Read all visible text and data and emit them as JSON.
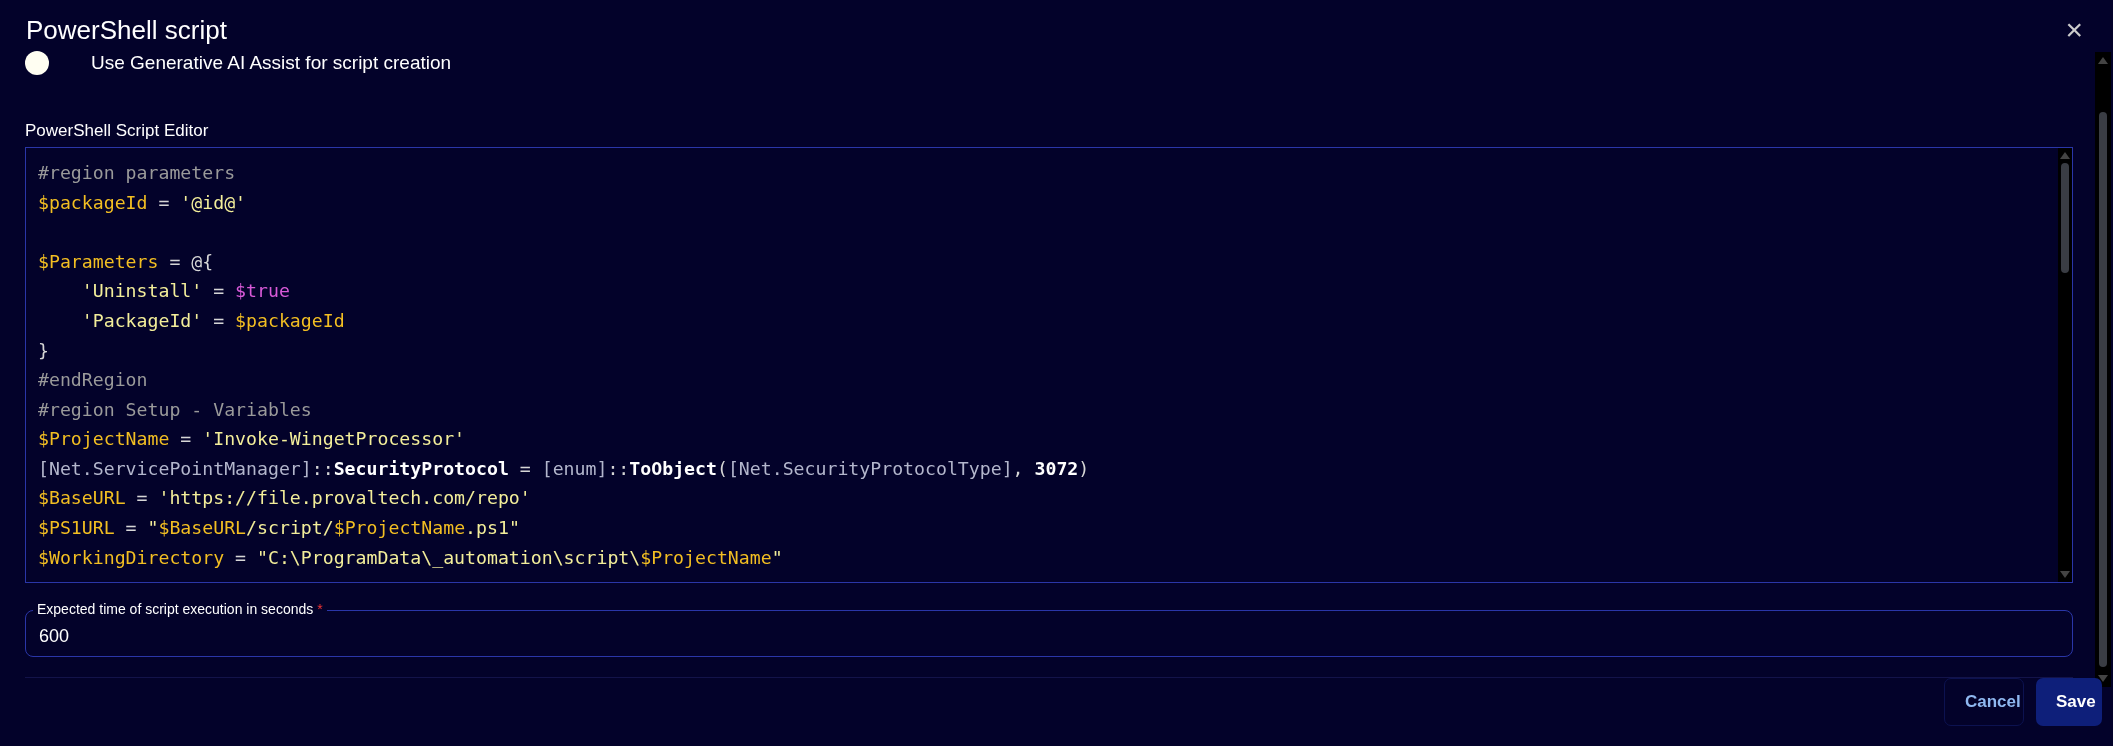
{
  "dialog": {
    "title": "PowerShell script",
    "close": "×"
  },
  "ai_toggle": {
    "label": "Use Generative AI Assist for script creation",
    "on": false
  },
  "editor": {
    "label": "PowerShell Script Editor",
    "lines": [
      {
        "kind": "code",
        "tokens": [
          {
            "t": "#region parameters",
            "kind": "comment"
          }
        ]
      },
      {
        "kind": "code",
        "tokens": [
          {
            "t": "$packageId",
            "kind": "var"
          },
          {
            "t": " = ",
            "kind": "op"
          },
          {
            "t": "'@id@'",
            "kind": "str"
          }
        ]
      },
      {
        "kind": "blank"
      },
      {
        "kind": "code",
        "tokens": [
          {
            "t": "$Parameters",
            "kind": "var"
          },
          {
            "t": " = @{",
            "kind": "op"
          }
        ]
      },
      {
        "kind": "code",
        "indent": true,
        "tokens": [
          {
            "t": "'Uninstall'",
            "kind": "str"
          },
          {
            "t": " = ",
            "kind": "op"
          },
          {
            "t": "$true",
            "kind": "bool"
          }
        ]
      },
      {
        "kind": "code",
        "indent": true,
        "tokens": [
          {
            "t": "'PackageId'",
            "kind": "str"
          },
          {
            "t": " = ",
            "kind": "op"
          },
          {
            "t": "$packageId",
            "kind": "var"
          }
        ]
      },
      {
        "kind": "code",
        "tokens": [
          {
            "t": "}",
            "kind": "op"
          }
        ]
      },
      {
        "kind": "code",
        "tokens": [
          {
            "t": "#endRegion",
            "kind": "comment"
          }
        ]
      },
      {
        "kind": "code",
        "tokens": [
          {
            "t": "#region Setup - Variables",
            "kind": "comment"
          }
        ]
      },
      {
        "kind": "code",
        "tokens": [
          {
            "t": "$ProjectName",
            "kind": "var"
          },
          {
            "t": " = ",
            "kind": "op"
          },
          {
            "t": "'Invoke-WingetProcessor'",
            "kind": "str"
          }
        ]
      },
      {
        "kind": "code",
        "tokens": [
          {
            "t": "[Net.ServicePointManager]",
            "kind": "type"
          },
          {
            "t": "::",
            "kind": "op"
          },
          {
            "t": "SecurityProtocol",
            "kind": "member"
          },
          {
            "t": " = ",
            "kind": "op"
          },
          {
            "t": "[enum]",
            "kind": "type"
          },
          {
            "t": "::",
            "kind": "op"
          },
          {
            "t": "ToObject",
            "kind": "member"
          },
          {
            "t": "(",
            "kind": "op"
          },
          {
            "t": "[Net.SecurityProtocolType]",
            "kind": "type"
          },
          {
            "t": ", ",
            "kind": "op"
          },
          {
            "t": "3072",
            "kind": "member"
          },
          {
            "t": ")",
            "kind": "op"
          }
        ]
      },
      {
        "kind": "code",
        "tokens": [
          {
            "t": "$BaseURL",
            "kind": "var"
          },
          {
            "t": " = ",
            "kind": "op"
          },
          {
            "t": "'https://file.provaltech.com/repo'",
            "kind": "str"
          }
        ]
      },
      {
        "kind": "code",
        "tokens": [
          {
            "t": "$PS1URL",
            "kind": "var"
          },
          {
            "t": " = ",
            "kind": "op"
          },
          {
            "t": "\"",
            "kind": "str"
          },
          {
            "t": "$BaseURL",
            "kind": "var"
          },
          {
            "t": "/script/",
            "kind": "str"
          },
          {
            "t": "$ProjectName",
            "kind": "var"
          },
          {
            "t": ".ps1\"",
            "kind": "str"
          }
        ]
      },
      {
        "kind": "code",
        "tokens": [
          {
            "t": "$WorkingDirectory",
            "kind": "var"
          },
          {
            "t": " = ",
            "kind": "op"
          },
          {
            "t": "\"C:\\ProgramData\\_automation\\script\\",
            "kind": "str"
          },
          {
            "t": "$ProjectName",
            "kind": "var"
          },
          {
            "t": "\"",
            "kind": "str"
          }
        ]
      }
    ]
  },
  "timeout_field": {
    "label": "Expected time of script execution in seconds",
    "required_mark": "*",
    "value": "600"
  },
  "buttons": [
    {
      "label": "Cancel",
      "kind": "secondary"
    },
    {
      "label": "Save",
      "kind": "primary"
    }
  ]
}
